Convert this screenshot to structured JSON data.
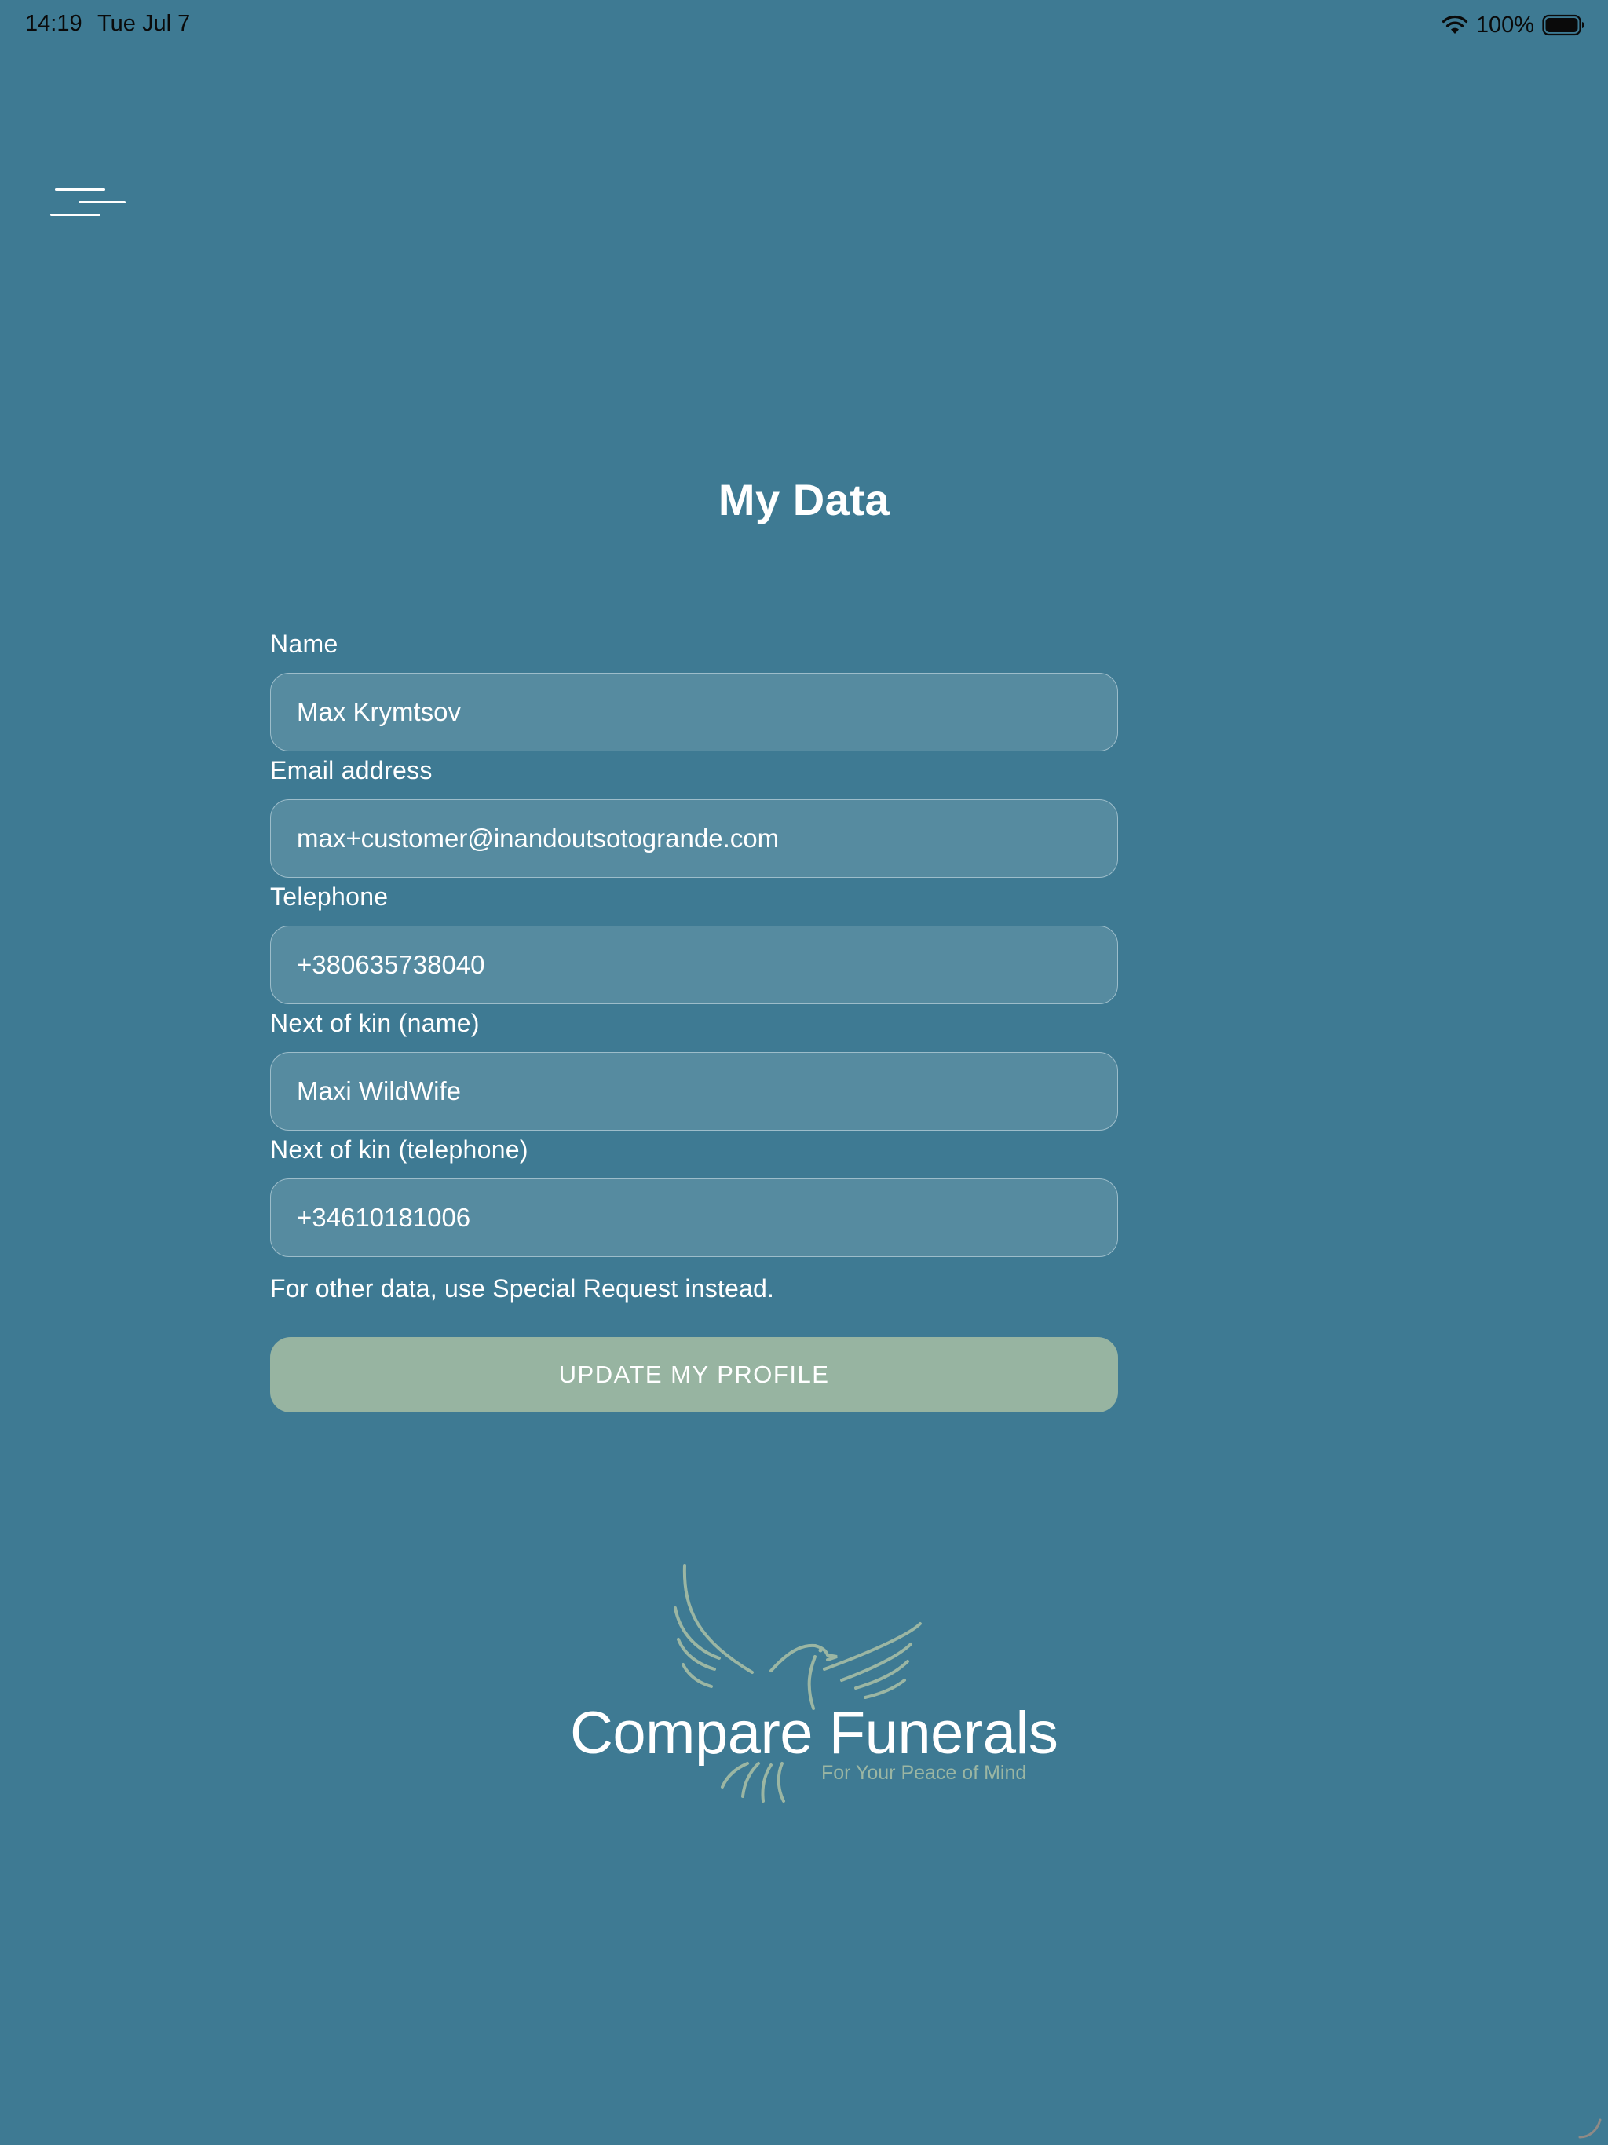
{
  "status_bar": {
    "time": "14:19",
    "date": "Tue Jul 7",
    "battery_percent": "100%"
  },
  "page": {
    "title": "My Data"
  },
  "form": {
    "fields": [
      {
        "label": "Name",
        "value": "Max Krymtsov"
      },
      {
        "label": "Email address",
        "value": "max+customer@inandoutsotogrande.com"
      },
      {
        "label": "Telephone",
        "value": "+380635738040"
      },
      {
        "label": "Next of kin (name)",
        "value": "Maxi WildWife"
      },
      {
        "label": "Next of kin (telephone)",
        "value": "+34610181006"
      }
    ],
    "helper_text": "For other data, use Special Request instead.",
    "submit_label": "UPDATE MY PROFILE"
  },
  "logo": {
    "name": "Compare Funerals",
    "tagline": "For Your Peace of Mind"
  },
  "colors": {
    "background": "#3e7a93",
    "input_fill": "#568ba0",
    "button_fill": "#97b4a1",
    "logo_accent": "#9bb6a3"
  },
  "icons": {
    "menu": "hamburger-icon",
    "wifi": "wifi-icon",
    "battery": "battery-icon",
    "logo": "dove-icon"
  }
}
